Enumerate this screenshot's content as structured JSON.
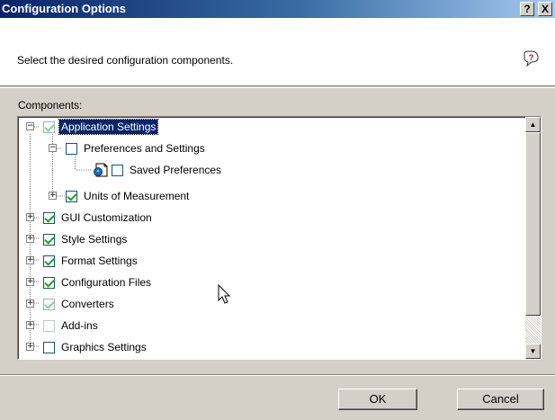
{
  "window": {
    "title": "Configuration Options",
    "help_button": "?",
    "close_button": "X"
  },
  "header": {
    "instruction": "Select the desired configuration components."
  },
  "components": {
    "label": "Components:",
    "tree": [
      {
        "label": "Application Settings",
        "checked": true,
        "greyed": true,
        "selected": true,
        "expander": "minus"
      },
      {
        "label": "Preferences and Settings",
        "checked": false,
        "expander": "minus"
      },
      {
        "label": "Saved Preferences",
        "checked": false,
        "icon": "preferences-file-icon"
      },
      {
        "label": "Units of Measurement",
        "checked": true,
        "expander": "plus"
      },
      {
        "label": "GUI Customization",
        "checked": true,
        "expander": "plus"
      },
      {
        "label": "Style Settings",
        "checked": true,
        "expander": "plus"
      },
      {
        "label": "Format Settings",
        "checked": true,
        "expander": "plus"
      },
      {
        "label": "Configuration Files",
        "checked": true,
        "expander": "plus"
      },
      {
        "label": "Converters",
        "checked": true,
        "greyed": true,
        "expander": "plus"
      },
      {
        "label": "Add-ins",
        "checked": false,
        "greyed": true,
        "expander": "plus"
      },
      {
        "label": "Graphics Settings",
        "checked": false,
        "expander": "plus"
      }
    ]
  },
  "buttons": {
    "ok": "OK",
    "cancel": "Cancel"
  },
  "icons": {
    "help": "help-bubble-icon",
    "file": "preferences-file-icon",
    "cursor": "mouse-pointer-icon"
  }
}
